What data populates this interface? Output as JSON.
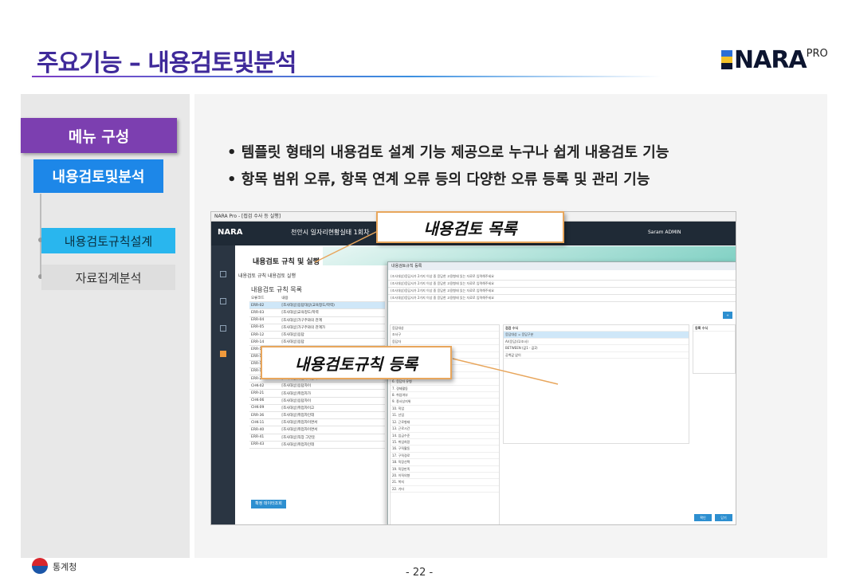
{
  "title": "주요기능 – 내용검토및분석",
  "logo": {
    "text": "NARA",
    "sup": "PRO"
  },
  "menu": {
    "header": "메뉴 구성",
    "main_item": "내용검토및분석",
    "sub_items": [
      "내용검토규칙설계",
      "자료집계분석"
    ]
  },
  "bullets": [
    "템플릿 형태의 내용검토 설계 기능 제공으로 누구나 쉽게 내용검토 기능",
    "항목 범위 오류, 항목 연계 오류 등의 다양한 오류 등록 및 관리 기능"
  ],
  "callouts": {
    "list": "내용검토 목록",
    "register": "내용검토규칙 등록"
  },
  "screenshot": {
    "window_title": "NARA Pro - [접검 수사 등 실행]",
    "app_logo": "NARA",
    "header_title": "천안시 일자리현황실태 1회차",
    "user": "Saram ADMIN",
    "page_title": "내용검토 규칙 및 실행",
    "tabs": "내용검토 규칙   내용검토 실행",
    "list_title": "내용검토 규칙 목록",
    "table_header": [
      "오류코드",
      "내용"
    ],
    "rows": [
      [
        "ERR-02",
        "[조사대상]응답대상(교육정도/학력)"
      ],
      [
        "ERR-03",
        "[조사대상]교육정도/학력"
      ],
      [
        "ERR-04",
        "[조사대상]가구주와의 관계"
      ],
      [
        "ERR-05",
        "[조사대상]가구주와의 관계가"
      ],
      [
        "ERR-12",
        "[조사대상]응답"
      ],
      [
        "ERR-14",
        "[조사대상]응답"
      ],
      [
        "ERR-15",
        "[조사대상]응답"
      ],
      [
        "ERR-16",
        "[조사대상]응답"
      ],
      [
        "ERR-17",
        "[조사대상]가구원중가정주"
      ],
      [
        "ERR-18",
        "[조사대상]취업자이면서"
      ],
      [
        "ERR-20",
        "[조사대상]취업자이면서"
      ],
      [
        "CHK-02",
        "[조사대상]응답자이"
      ],
      [
        "ERR-21",
        "[조사대상]취업자가"
      ],
      [
        "CHK-06",
        "[조사대상]응답자이"
      ],
      [
        "CHK-09",
        "[조사대상]취업자이고"
      ],
      [
        "ERR-36",
        "[조사대상]취업자인데"
      ],
      [
        "CHK-11",
        "[조사대상]취업자이면서"
      ],
      [
        "ERR-40",
        "[조사대상]취업자이면서"
      ],
      [
        "ERR-41",
        "[조사대상]직장 그만둔"
      ],
      [
        "ERR-43",
        "[조사대상]취업자인데"
      ]
    ],
    "save_button": "확정 데이터조회",
    "dialog_title": "내용검토규칙 등록",
    "dialog_rows": [
      "(조사대상)응답사가 2가지 이상 중 응답한 고용형태 있는 자료로 입력해주세요",
      "(조사대상)응답사가 2가지 이상 중 응답한 고용형태 있는 자료로 입력해주세요",
      "(조사대상)응답사가 2가지 이상 중 응답한 고용형태 있는 자료로 입력해주세요",
      "(조사대상)응답사가 2가지 이상 중 응답한 고용형태 있는 자료로 입력해주세요"
    ],
    "dialog_section_left": "검검 수식",
    "dialog_section_right": "등록 수식",
    "dialog_list": [
      "응답대상",
      "조사구",
      "응답자",
      "1. 성별",
      "2. 연령",
      "3. 교육정도",
      "4. 혼인상태",
      "5. 가구주와의 관계",
      "6. 응답자 유형",
      "7. 경제활동",
      "8. 취업여부",
      "9. 종사상지위",
      "10. 직업",
      "11. 산업",
      "12. 근로형태",
      "13. 근로시간",
      "14. 임금수준",
      "15. 취업희망",
      "16. 구직활동",
      "17. 구직경로",
      "18. 직장선택",
      "19. 직장만족",
      "20. 이직의향",
      "21. 복지",
      "22. 기타"
    ],
    "formula_rows": [
      "응답대상 = 응답구분",
      "A/(응답)(1/조사)",
      "BETWEEN (값1 - 값2)",
      "공백값 없이"
    ],
    "ok_button": "확인",
    "cancel_button": "닫기"
  },
  "footer": {
    "org": "통계청",
    "page": "- 22 -"
  }
}
